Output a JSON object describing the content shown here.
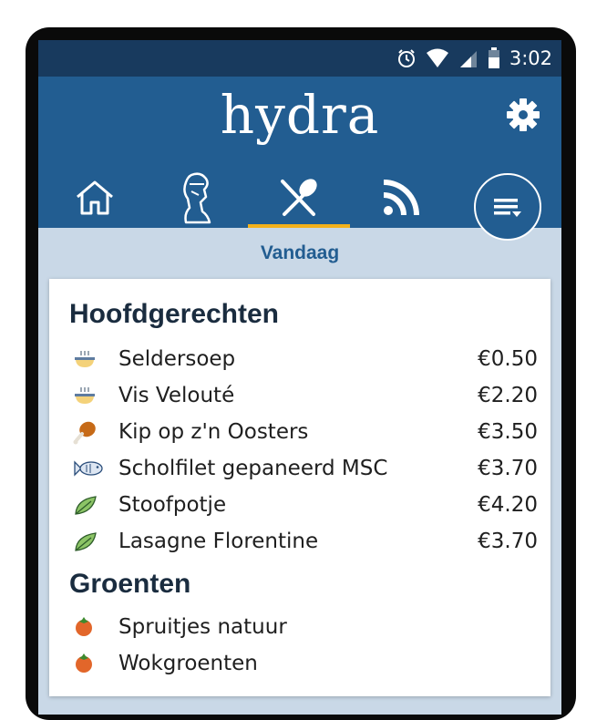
{
  "status": {
    "time": "3:02"
  },
  "app": {
    "logo": "hydra"
  },
  "tabs": [
    {
      "name": "home",
      "icon": "home-icon"
    },
    {
      "name": "minerva",
      "icon": "minerva-icon"
    },
    {
      "name": "resto",
      "icon": "fork-knife-icon"
    },
    {
      "name": "feed",
      "icon": "rss-icon"
    }
  ],
  "day_label": "Vandaag",
  "sections": [
    {
      "title": "Hoofdgerechten",
      "items": [
        {
          "name": "Seldersoep",
          "price": "€0.50",
          "icon": "soup-icon"
        },
        {
          "name": "Vis Velouté",
          "price": "€2.20",
          "icon": "soup-icon"
        },
        {
          "name": "Kip op z'n Oosters",
          "price": "€3.50",
          "icon": "chicken-leg-icon"
        },
        {
          "name": "Scholfilet gepaneerd MSC",
          "price": "€3.70",
          "icon": "fish-icon"
        },
        {
          "name": "Stoofpotje",
          "price": "€4.20",
          "icon": "leaf-icon"
        },
        {
          "name": "Lasagne Florentine",
          "price": "€3.70",
          "icon": "leaf-icon"
        }
      ]
    },
    {
      "title": "Groenten",
      "items": [
        {
          "name": "Spruitjes natuur",
          "icon": "tomato-icon"
        },
        {
          "name": "Wokgroenten",
          "icon": "tomato-icon"
        }
      ]
    }
  ],
  "colors": {
    "appbar": "#225d91",
    "statusbar": "#183a5e",
    "accent": "#f3b11a",
    "background": "#c9d8e7"
  }
}
